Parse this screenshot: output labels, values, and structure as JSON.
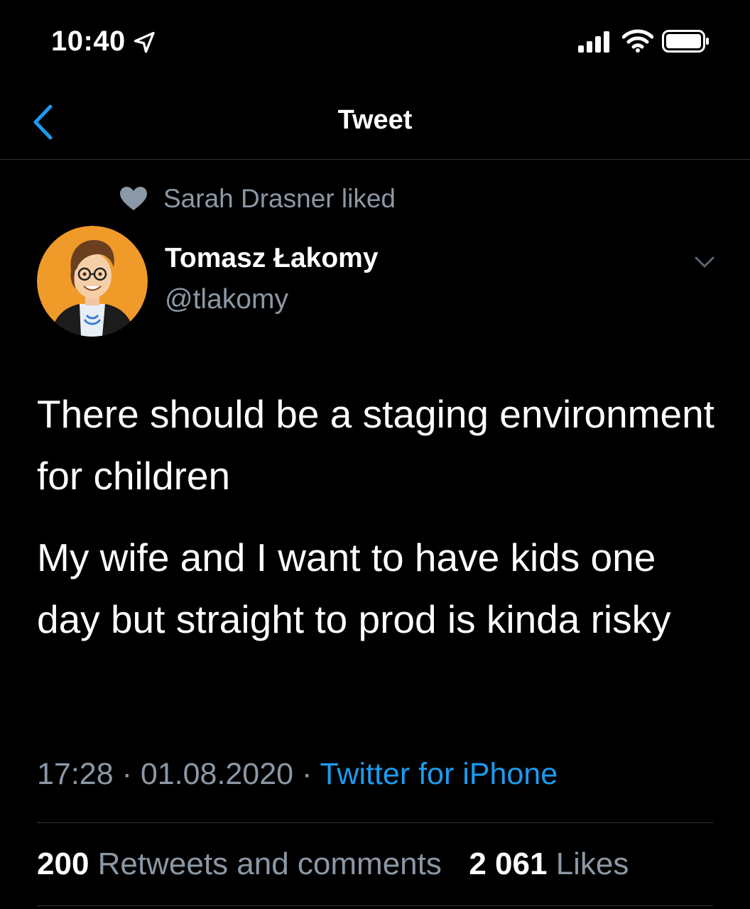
{
  "status_bar": {
    "time": "10:40",
    "icons": [
      "location-arrow-icon",
      "signal-bars-icon",
      "wifi-icon",
      "battery-icon"
    ]
  },
  "nav": {
    "title": "Tweet",
    "back_icon": "chevron-left-icon"
  },
  "social_context": {
    "text": "Sarah Drasner liked",
    "icon": "heart-icon"
  },
  "author": {
    "name": "Tomasz Łakomy",
    "handle": "@tlakomy"
  },
  "tweet": {
    "paragraphs": [
      "There should be a staging environment for children",
      "My wife and I want to have kids one day but straight to prod is kinda risky"
    ]
  },
  "meta": {
    "time": "17:28",
    "separator": "·",
    "date": "01.08.2020",
    "source": "Twitter for iPhone"
  },
  "stats": {
    "retweets_count": "200",
    "retweets_label": "Retweets and comments",
    "likes_count": "2 061",
    "likes_label": "Likes"
  },
  "colors": {
    "background": "#000000",
    "text_primary": "#ffffff",
    "text_secondary": "#8b98a5",
    "accent": "#1d9bf0",
    "divider": "#2f3336",
    "avatar_bg": "#f09a2a"
  }
}
